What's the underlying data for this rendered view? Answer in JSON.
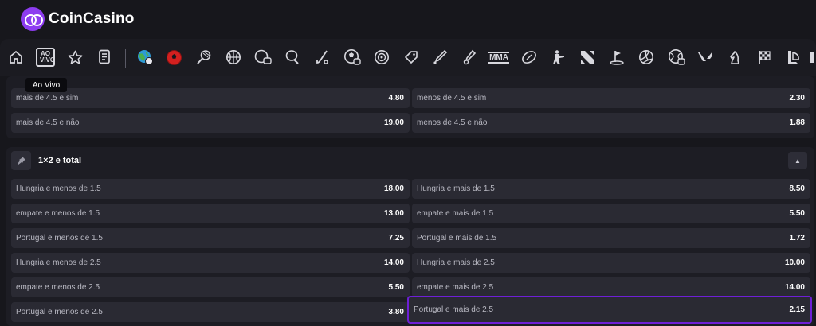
{
  "brand": {
    "name": "CoinCasino",
    "accent": "#8d3cf0"
  },
  "nav": {
    "icons": [
      "home-icon",
      "ao-vivo-icon",
      "star-icon",
      "betslip-icon",
      "sports-globe-icon",
      "soccer-ball-icon",
      "tennis-icon",
      "basketball-icon",
      "esports-icon",
      "table-tennis-icon",
      "hockey-icon",
      "ball-icon",
      "target-icon",
      "tag-icon",
      "cricket-bat-icon",
      "baseball-icon",
      "mma-icon",
      "american-football-icon",
      "counter-strike-icon",
      "dota-icon",
      "golf-icon",
      "volleyball-icon",
      "rugby-icon",
      "valorant-icon",
      "chess-icon",
      "racing-flag-icon",
      "league-of-legends-icon"
    ],
    "ao_vivo_label": "AO\nVIVO",
    "mma_label": "MMA",
    "tooltip": "Ao Vivo"
  },
  "market_prev": {
    "rows": [
      {
        "left": {
          "label": "mais de 4.5 e sim",
          "odds": "4.80"
        },
        "right": {
          "label": "menos de 4.5 e sim",
          "odds": "2.30"
        }
      },
      {
        "left": {
          "label": "mais de 4.5 e não",
          "odds": "19.00"
        },
        "right": {
          "label": "menos de 4.5 e não",
          "odds": "1.88"
        }
      }
    ]
  },
  "market_1x2_total": {
    "title": "1×2 e total",
    "rows": [
      {
        "left": {
          "label": "Hungria e menos de 1.5",
          "odds": "18.00"
        },
        "right": {
          "label": "Hungria e mais de 1.5",
          "odds": "8.50"
        }
      },
      {
        "left": {
          "label": "empate e menos de 1.5",
          "odds": "13.00"
        },
        "right": {
          "label": "empate e mais de 1.5",
          "odds": "5.50"
        }
      },
      {
        "left": {
          "label": "Portugal e menos de 1.5",
          "odds": "7.25"
        },
        "right": {
          "label": "Portugal e mais de 1.5",
          "odds": "1.72"
        }
      },
      {
        "left": {
          "label": "Hungria e menos de 2.5",
          "odds": "14.00"
        },
        "right": {
          "label": "Hungria e mais de 2.5",
          "odds": "10.00"
        }
      },
      {
        "left": {
          "label": "empate e menos de 2.5",
          "odds": "5.50"
        },
        "right": {
          "label": "empate e mais de 2.5",
          "odds": "14.00"
        }
      },
      {
        "left": {
          "label": "Portugal e menos de 2.5",
          "odds": "3.80"
        },
        "right": {
          "label": "Portugal e mais de 2.5",
          "odds": "2.15",
          "selected": true
        }
      }
    ]
  },
  "colors": {
    "background": "#17171c",
    "cell": "#2a2a33",
    "selected_border": "#6e1fd6"
  }
}
